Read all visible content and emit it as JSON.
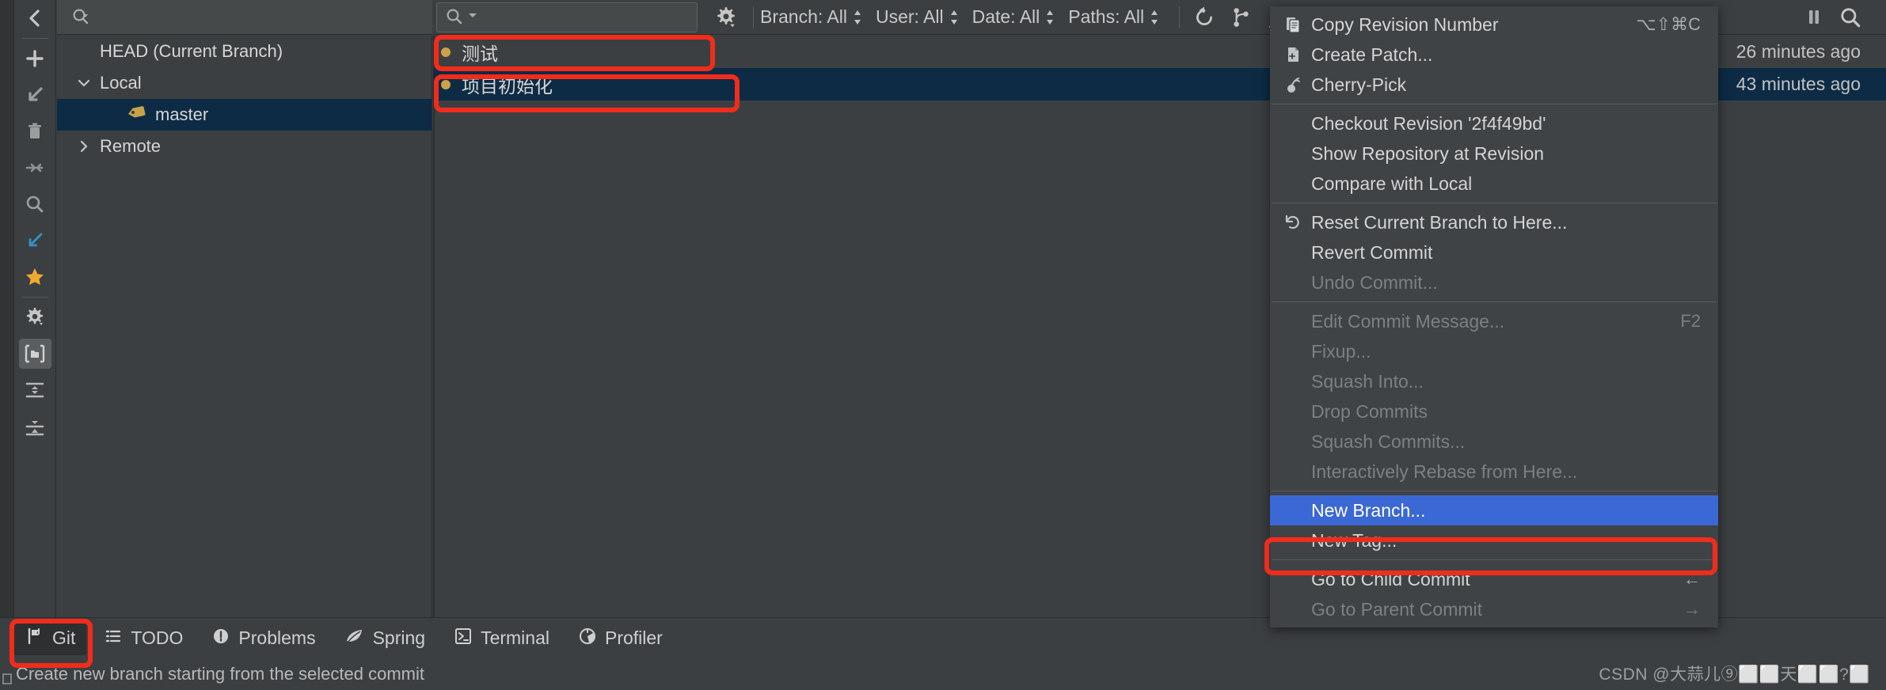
{
  "left_rail": {
    "items": [
      {
        "name": "collapse-back-icon",
        "glyph": "chevron-left"
      },
      {
        "name": "add-icon",
        "glyph": "plus"
      },
      {
        "name": "checkout-icon",
        "glyph": "arrow-down-left"
      },
      {
        "name": "delete-icon",
        "glyph": "trash"
      },
      {
        "name": "compare-icon",
        "glyph": "arrows-merge"
      },
      {
        "name": "search-icon",
        "glyph": "magnifier"
      },
      {
        "name": "update-project-icon",
        "glyph": "arrow-down-left-blue"
      },
      {
        "name": "favorite-icon",
        "glyph": "star"
      },
      {
        "name": "settings-icon",
        "glyph": "gear"
      },
      {
        "name": "show-branches-icon",
        "glyph": "folder-brackets"
      },
      {
        "name": "collapse-all-icon",
        "glyph": "collapse-lines"
      },
      {
        "name": "expand-all-icon",
        "glyph": "expand-lines"
      }
    ]
  },
  "branch_panel": {
    "search_placeholder": "",
    "tree": [
      {
        "label": "HEAD (Current Branch)",
        "level": 0,
        "arrow": "",
        "selected": false,
        "tag": false
      },
      {
        "label": "Local",
        "level": 1,
        "arrow": "down",
        "selected": false,
        "tag": false
      },
      {
        "label": "master",
        "level": 2,
        "arrow": "",
        "selected": true,
        "tag": true
      },
      {
        "label": "Remote",
        "level": 1,
        "arrow": "right",
        "selected": false,
        "tag": false
      }
    ]
  },
  "log_toolbar": {
    "search_placeholder": "",
    "gear_label": "gear",
    "filters": [
      {
        "label": "Branch: All"
      },
      {
        "label": "User: All"
      },
      {
        "label": "Date: All"
      },
      {
        "label": "Paths: All"
      }
    ],
    "right_icons": [
      {
        "name": "refresh-icon"
      },
      {
        "name": "git-branch-icon"
      },
      {
        "name": "push-icon"
      },
      {
        "name": "history-icon"
      },
      {
        "name": "show-details-icon"
      },
      {
        "name": "pause-icon"
      },
      {
        "name": "find-icon"
      }
    ]
  },
  "commits": [
    {
      "message": "测试",
      "time": "26 minutes ago",
      "selected": false
    },
    {
      "message": "项目初始化",
      "time": "43 minutes ago",
      "selected": true
    }
  ],
  "context_menu": {
    "groups": [
      {
        "items": [
          {
            "label": "Copy Revision Number",
            "accel": "⌥⇧⌘C",
            "icon": "copy-icon",
            "disabled": false,
            "highlight": false
          },
          {
            "label": "Create Patch...",
            "accel": "",
            "icon": "patch-icon",
            "disabled": false,
            "highlight": false
          },
          {
            "label": "Cherry-Pick",
            "accel": "",
            "icon": "cherry-icon",
            "disabled": false,
            "highlight": false
          }
        ]
      },
      {
        "items": [
          {
            "label": "Checkout Revision '2f4f49bd'",
            "accel": "",
            "icon": "",
            "disabled": false,
            "highlight": false
          },
          {
            "label": "Show Repository at Revision",
            "accel": "",
            "icon": "",
            "disabled": false,
            "highlight": false
          },
          {
            "label": "Compare with Local",
            "accel": "",
            "icon": "",
            "disabled": false,
            "highlight": false
          }
        ]
      },
      {
        "items": [
          {
            "label": "Reset Current Branch to Here...",
            "accel": "",
            "icon": "reset-icon",
            "disabled": false,
            "highlight": false
          },
          {
            "label": "Revert Commit",
            "accel": "",
            "icon": "",
            "disabled": false,
            "highlight": false
          },
          {
            "label": "Undo Commit...",
            "accel": "",
            "icon": "",
            "disabled": true,
            "highlight": false
          }
        ]
      },
      {
        "items": [
          {
            "label": "Edit Commit Message...",
            "accel": "F2",
            "icon": "",
            "disabled": true,
            "highlight": false
          },
          {
            "label": "Fixup...",
            "accel": "",
            "icon": "",
            "disabled": true,
            "highlight": false
          },
          {
            "label": "Squash Into...",
            "accel": "",
            "icon": "",
            "disabled": true,
            "highlight": false
          },
          {
            "label": "Drop Commits",
            "accel": "",
            "icon": "",
            "disabled": true,
            "highlight": false
          },
          {
            "label": "Squash Commits...",
            "accel": "",
            "icon": "",
            "disabled": true,
            "highlight": false
          },
          {
            "label": "Interactively Rebase from Here...",
            "accel": "",
            "icon": "",
            "disabled": true,
            "highlight": false
          }
        ]
      },
      {
        "items": [
          {
            "label": "New Branch...",
            "accel": "",
            "icon": "",
            "disabled": false,
            "highlight": true
          },
          {
            "label": "New Tag...",
            "accel": "",
            "icon": "",
            "disabled": false,
            "highlight": false
          }
        ]
      },
      {
        "items": [
          {
            "label": "Go to Child Commit",
            "accel": "←",
            "icon": "",
            "disabled": false,
            "highlight": false
          },
          {
            "label": "Go to Parent Commit",
            "accel": "→",
            "icon": "",
            "disabled": true,
            "highlight": false
          }
        ]
      }
    ]
  },
  "tool_windows": [
    {
      "label": "Git",
      "icon": "git-icon",
      "active": true
    },
    {
      "label": "TODO",
      "icon": "todo-list-icon",
      "active": false
    },
    {
      "label": "Problems",
      "icon": "problems-icon",
      "active": false
    },
    {
      "label": "Spring",
      "icon": "spring-leaf-icon",
      "active": false
    },
    {
      "label": "Terminal",
      "icon": "terminal-icon",
      "active": false
    },
    {
      "label": "Profiler",
      "icon": "profiler-icon",
      "active": false
    }
  ],
  "status_bar": {
    "message": "Create new branch starting from the selected commit",
    "watermark": "CSDN @大蒜儿⑨⬜⬜天⬜⬜?⬜"
  },
  "colors": {
    "accent_highlight": "#3b68d4",
    "selection": "#0d2b45",
    "annotation": "#f22c1c",
    "tag_gold": "#c9a24a",
    "star_gold": "#f0a930",
    "blue_icon": "#3592c4"
  }
}
